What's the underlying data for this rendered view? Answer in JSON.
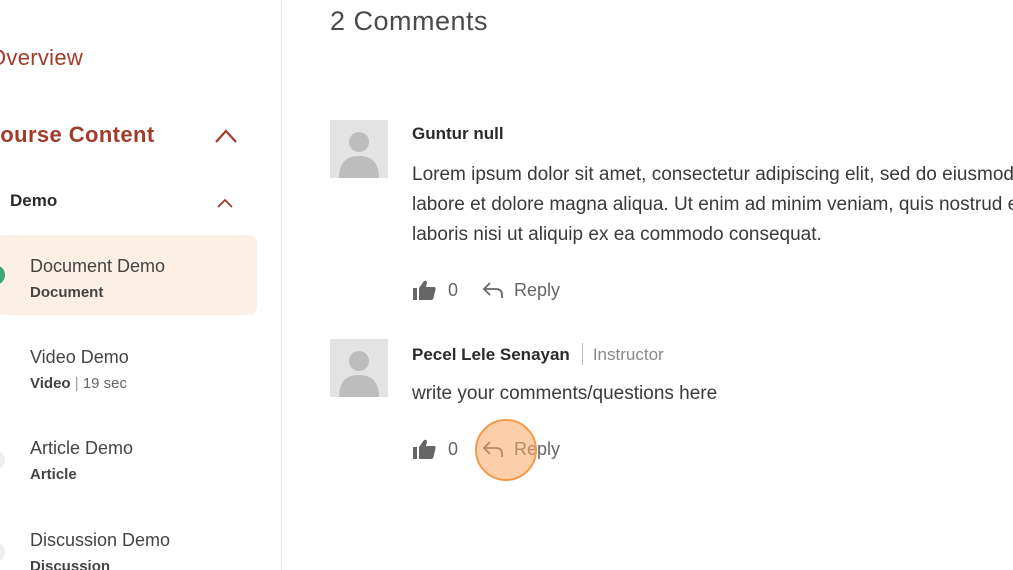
{
  "sidebar": {
    "overview": "Overview",
    "course_content": "Course Content",
    "section": "Demo",
    "lessons": [
      {
        "title": "Document Demo",
        "type": "Document",
        "duration": "",
        "active": true
      },
      {
        "title": "Video Demo",
        "type": "Video",
        "duration": "19 sec",
        "active": false
      },
      {
        "title": "Article Demo",
        "type": "Article",
        "duration": "",
        "active": false
      },
      {
        "title": "Discussion Demo",
        "type": "Discussion",
        "duration": "",
        "active": false
      }
    ]
  },
  "comments": {
    "heading": "2 Comments",
    "items": [
      {
        "author": "Guntur null",
        "role": "",
        "lines": [
          "Lorem ipsum dolor sit amet, consectetur adipiscing elit, sed do eiusmod tempor incididunt ut",
          "labore et dolore magna aliqua. Ut enim ad minim veniam, quis nostrud exercitation ullamco",
          "laboris nisi ut aliquip ex ea commodo consequat."
        ],
        "likes": "0",
        "reply_label": "Reply"
      },
      {
        "author": "Pecel Lele Senayan",
        "role": "Instructor",
        "lines": [
          "write your comments/questions here"
        ],
        "likes": "0",
        "reply_label": "Reply"
      }
    ]
  },
  "colors": {
    "accent": "#a23b2a",
    "active_bg": "#fbefe6",
    "progress_dot": "#3ba676",
    "click_indicator": "#f39a4a"
  },
  "icons": {
    "like": "thumbs-up-icon",
    "reply": "reply-arrow-icon",
    "collapse": "chevron-up-icon",
    "avatar": "user-placeholder-icon"
  }
}
